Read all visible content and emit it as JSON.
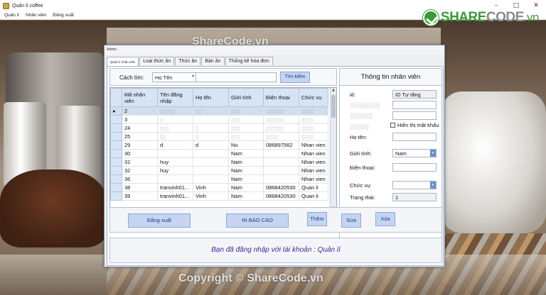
{
  "window": {
    "title": "Quản lí coffee",
    "controls": [
      "–",
      "□",
      "✕"
    ]
  },
  "menu": [
    "Quản lí",
    "Nhân viên",
    "Đăng xuất"
  ],
  "logo": {
    "part1": "SHARE",
    "part2": "CODE",
    "part3": ".vn"
  },
  "watermark_top": "ShareCode.vn",
  "watermark_bottom": "Copyright © ShareCode.vn",
  "form": {
    "title": "Admin",
    "tabs": [
      "Quản lí nhân viên",
      "Loại thức ăn",
      "Thức ăn",
      "Bàn ăn",
      "Thống kê hóa đơn"
    ],
    "search": {
      "label": "Cách tìm:",
      "selected": "Họ Tên",
      "value": "",
      "button": "Tìm kiếm"
    },
    "grid": {
      "columns": [
        "Mã nhân viên",
        "Tên đăng nhập",
        "Họ tên",
        "Giới tính",
        "Điện thoại",
        "Chức vụ"
      ],
      "rows": [
        [
          "2",
          "",
          "",
          "",
          "",
          ""
        ],
        [
          "3",
          "",
          "",
          "",
          "",
          ""
        ],
        [
          "24",
          "",
          "",
          "",
          "",
          ""
        ],
        [
          "25",
          "",
          "",
          "",
          "",
          ""
        ],
        [
          "29",
          "d",
          "d",
          "Nu",
          "086897562",
          "Nhan vien"
        ],
        [
          "30",
          "",
          "",
          "Nam",
          "",
          "Nhan vien"
        ],
        [
          "31",
          "huy",
          "",
          "Nam",
          "",
          "Nhan vien"
        ],
        [
          "32",
          "huy",
          "",
          "Nam",
          "",
          "Nhan vien"
        ],
        [
          "36",
          "",
          "",
          "Nam",
          "",
          "Nhan vien"
        ],
        [
          "38",
          "tranvinh01...",
          "Vinh",
          "Nam",
          "0868420530",
          "Quan li"
        ],
        [
          "39",
          "tranvinh01...",
          "Vinh",
          "Nam",
          "0868420530",
          "Quan li"
        ]
      ]
    },
    "info": {
      "heading": "Thông tin nhân viên",
      "id_label": "id:",
      "id_value": "ID Tự tăng",
      "show_password": "Hiển thị mật khẩu",
      "fullname_label": "Họ tên:",
      "gender_label": "Giới tính:",
      "gender_value": "Nam",
      "phone_label": "Điện thoại:",
      "position_label": "Chức vụ:",
      "position_value": "",
      "status_label": "Trạng thái:",
      "status_value": "1"
    },
    "buttons": {
      "logout": "Đăng xuất",
      "report": "IN BÁO CÁO",
      "add": "Thêm",
      "edit": "Sửa",
      "delete": "Xóa"
    },
    "status_message": "Bạn đã đăng nhập với tài khoản : Quản lí"
  }
}
